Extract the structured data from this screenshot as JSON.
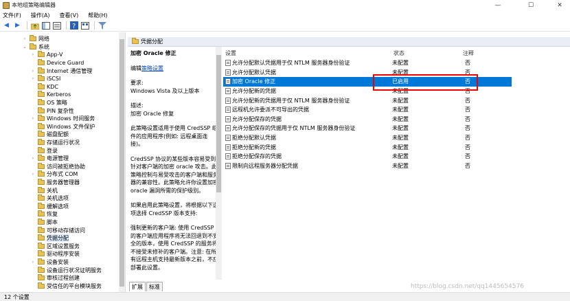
{
  "window": {
    "title": "本地组策略编辑器"
  },
  "menu": [
    "文件(F)",
    "操作(A)",
    "查看(V)",
    "帮助(H)"
  ],
  "tree": [
    {
      "label": "网络",
      "exp": "›"
    },
    {
      "label": "系统",
      "exp": "⌄"
    },
    {
      "label": "App-V",
      "exp": "›"
    },
    {
      "label": "Device Guard",
      "exp": ""
    },
    {
      "label": "Internet 通信管理",
      "exp": "›"
    },
    {
      "label": "iSCSI",
      "exp": "›"
    },
    {
      "label": "KDC",
      "exp": ""
    },
    {
      "label": "Kerberos",
      "exp": ""
    },
    {
      "label": "OS 策略",
      "exp": ""
    },
    {
      "label": "PIN 复杂性",
      "exp": ""
    },
    {
      "label": "Windows 时间服务",
      "exp": "›"
    },
    {
      "label": "Windows 文件保护",
      "exp": ""
    },
    {
      "label": "磁盘配额",
      "exp": ""
    },
    {
      "label": "存储运行状况",
      "exp": ""
    },
    {
      "label": "登录",
      "exp": ""
    },
    {
      "label": "电源管理",
      "exp": "›"
    },
    {
      "label": "访问被拒绝协助",
      "exp": ""
    },
    {
      "label": "分布式 COM",
      "exp": "›"
    },
    {
      "label": "服务器管理器",
      "exp": ""
    },
    {
      "label": "关机",
      "exp": ""
    },
    {
      "label": "关机选项",
      "exp": ""
    },
    {
      "label": "缓解选项",
      "exp": ""
    },
    {
      "label": "恢复",
      "exp": ""
    },
    {
      "label": "脚本",
      "exp": ""
    },
    {
      "label": "可移动存储访问",
      "exp": ""
    },
    {
      "label": "凭据分配",
      "exp": "",
      "selected": true
    },
    {
      "label": "区域设置服务",
      "exp": ""
    },
    {
      "label": "驱动程序安装",
      "exp": ""
    },
    {
      "label": "设备安装",
      "exp": "›"
    },
    {
      "label": "设备运行状况证明服务",
      "exp": ""
    },
    {
      "label": "审核过程创建",
      "exp": ""
    },
    {
      "label": "受信任的平台模块服务",
      "exp": ""
    }
  ],
  "right_header": "凭据分配",
  "desc": {
    "title": "加密 Oracle 修正",
    "edit_prefix": "编辑",
    "edit_link": "策略设置",
    "req": "要求:\nWindows Vista 及以上版本",
    "descr": "描述:\n加密 Oracle 修复",
    "p1": "此策略设置适用于使用 CredSSP 组件的应用程序(例如: 远程桌面连接)。",
    "p2": "CredSSP 协议的某些版本容易受到针对客户端的加密 oracle 攻击。此策略控制与易受攻击的客户端和服务器的兼容性。此策略允许你设置加密 oracle 漏洞所需的保护级别。",
    "p3": "如果启用此策略设置，将根据以下选项选择 CredSSP 版本支持:",
    "p4": "强制更新的客户端: 使用 CredSSP 的客户端应用程序将无法回退到不安全的版本，使用 CredSSP 的服务将不接受未修补的客户端。注意: 在所有远程主机支持最新版本之前，不应部署此设置。"
  },
  "columns": {
    "setting": "设置",
    "state": "状态",
    "note": "注释"
  },
  "rows": [
    {
      "name": "允许分配默认凭据用于仅 NTLM 服务器身份验证",
      "state": "未配置",
      "note": "否"
    },
    {
      "name": "允许分配默认凭据",
      "state": "未配置",
      "note": "否"
    },
    {
      "name": "加密 Oracle 修正",
      "state": "已启用",
      "note": "否",
      "selected": true
    },
    {
      "name": "允许分配新的凭据",
      "state": "未配置",
      "note": "否"
    },
    {
      "name": "允许分配新的凭据用于仅 NTLM 服务器身份验证",
      "state": "未配置",
      "note": "否"
    },
    {
      "name": "远程机允许委派不可导出的凭据",
      "state": "未配置",
      "note": "否"
    },
    {
      "name": "允许分配保存的凭据",
      "state": "未配置",
      "note": "否"
    },
    {
      "name": "允许分配保存的凭据用于仅 NTLM 服务器身份验证",
      "state": "未配置",
      "note": "否"
    },
    {
      "name": "拒绝分配默认凭据",
      "state": "未配置",
      "note": "否"
    },
    {
      "name": "拒绝分配新的凭据",
      "state": "未配置",
      "note": "否"
    },
    {
      "name": "拒绝分配保存的凭据",
      "state": "未配置",
      "note": "否"
    },
    {
      "name": "限制向远程服务器分配凭据",
      "state": "未配置",
      "note": "否"
    }
  ],
  "tabs": [
    "扩展",
    "标准"
  ],
  "status": "12 个设置",
  "watermark": "https://blog.csdn.net/qq1445654576"
}
